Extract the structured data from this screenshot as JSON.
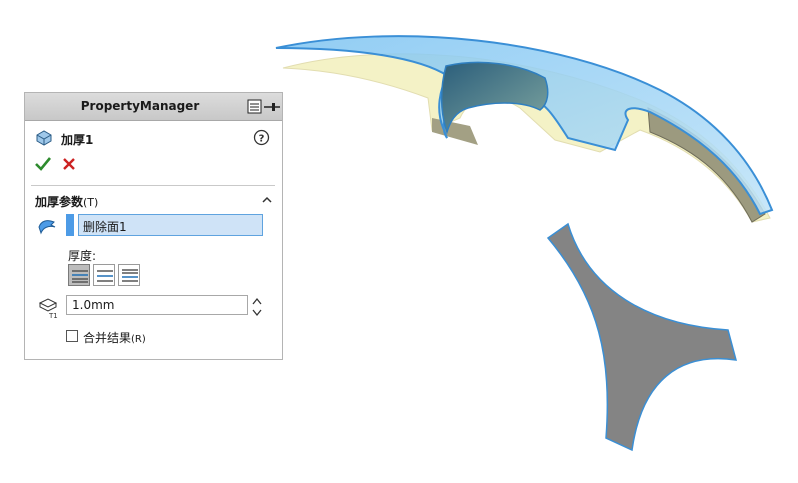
{
  "panel": {
    "title": "PropertyManager",
    "feature_name": "加厚1",
    "group": {
      "title": "加厚参数",
      "mnemonic": "(T)"
    },
    "faces": [
      "删除面1"
    ],
    "face_color": "#4d9be6",
    "thickness_label": "厚度:",
    "thickness_value": "1.0mm",
    "merge_result": {
      "label": "合并结果",
      "mnemonic": "(R)",
      "checked": false
    },
    "side_options": [
      "side-1-icon",
      "both-sides-icon",
      "side-2-icon"
    ],
    "active_side": 0
  },
  "icons": {
    "feature": "thicken-feature-icon",
    "help": "help-icon",
    "pin": "pin-icon",
    "ok": "checkmark-icon",
    "cancel": "x-icon",
    "collapse": "chevron-up-icon",
    "faces": "face-select-icon",
    "thickness": "thickness-t1-icon",
    "spin": "up-down-arrows-icon"
  },
  "colors": {
    "selection_blue": "#4d9be6",
    "ok_green": "#2e8b2e",
    "cancel_red": "#cc2222",
    "surface_gray": "#848484"
  }
}
